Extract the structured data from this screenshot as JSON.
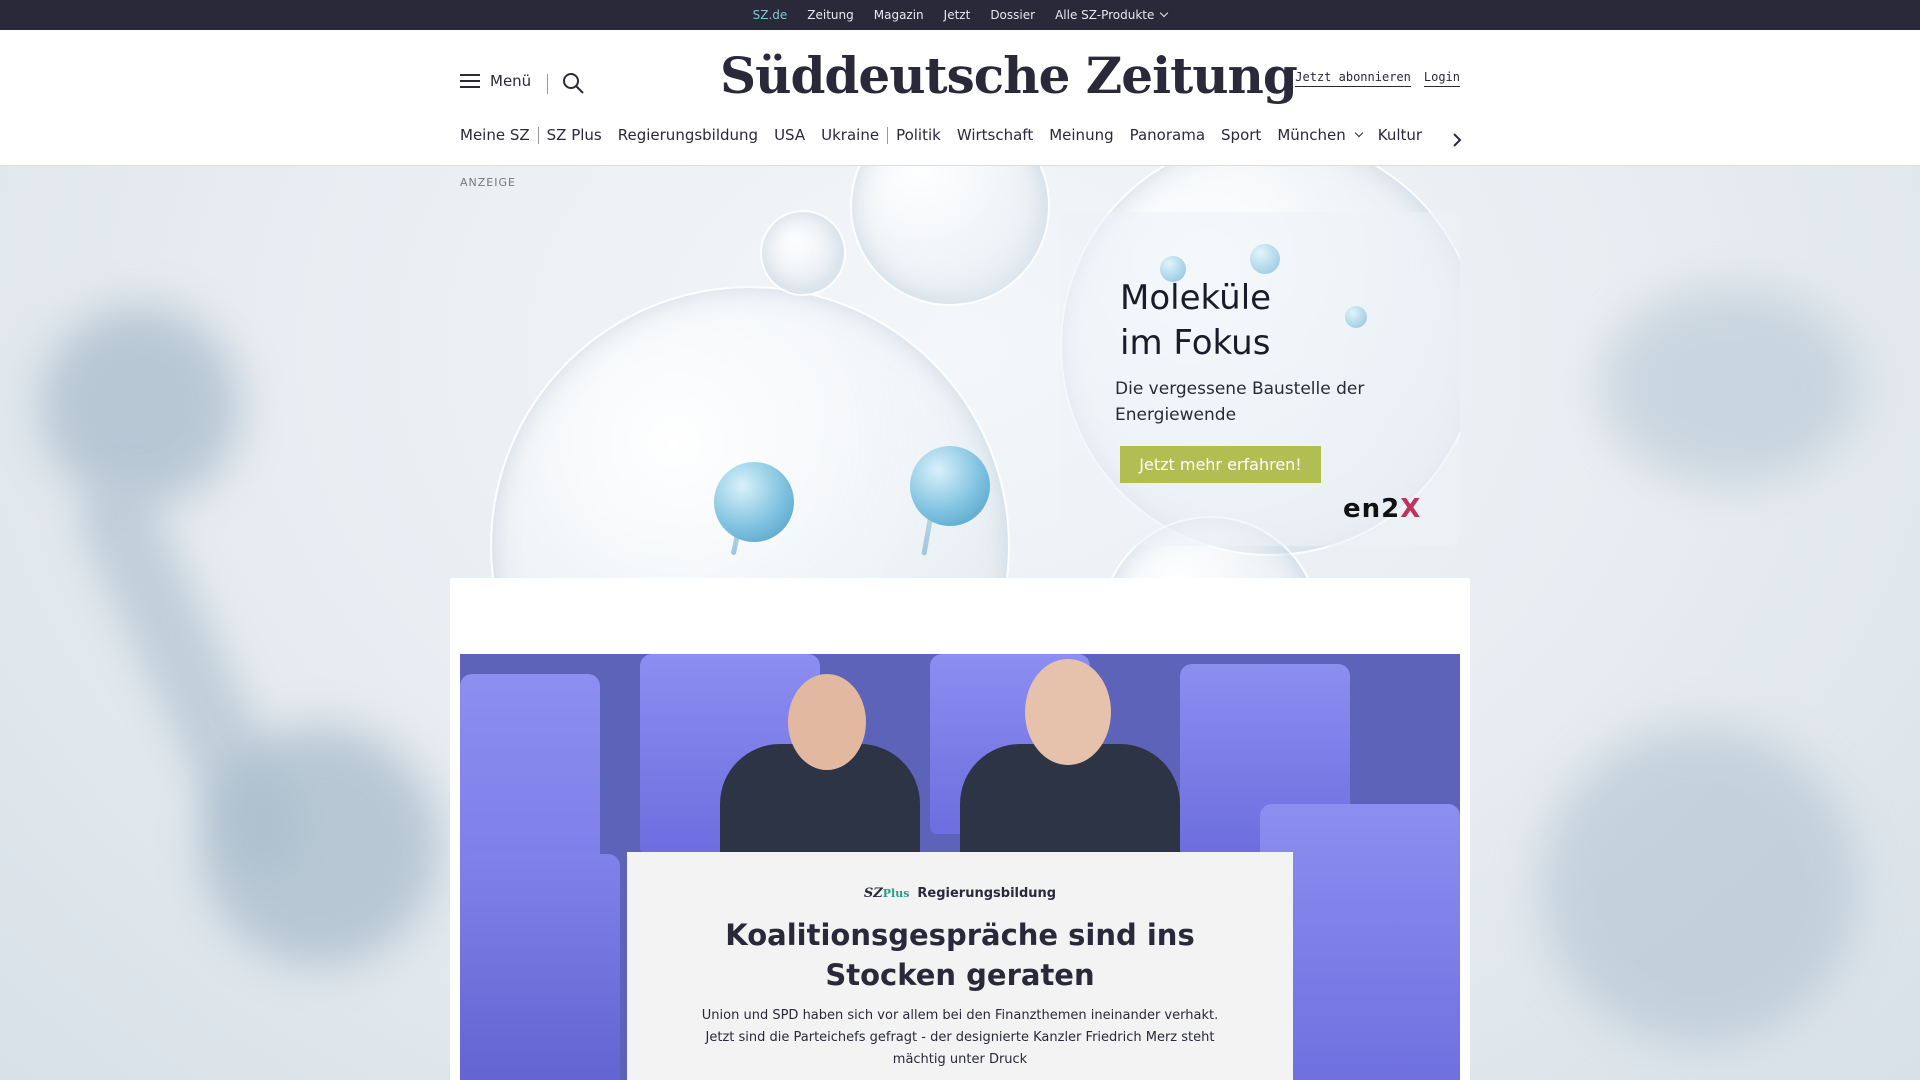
{
  "topbar": {
    "links": [
      "SZ.de",
      "Zeitung",
      "Magazin",
      "Jetzt",
      "Dossier",
      "Alle SZ-Produkte"
    ]
  },
  "header": {
    "menu_label": "Menü",
    "logo": "Süddeutsche Zeitung",
    "subscribe": "Jetzt abonnieren",
    "login": "Login"
  },
  "nav": {
    "items": [
      "Meine SZ",
      "SZ Plus",
      "Regierungsbildung",
      "USA",
      "Ukraine",
      "Politik",
      "Wirtschaft",
      "Meinung",
      "Panorama",
      "Sport",
      "München",
      "Kultur"
    ]
  },
  "ad": {
    "label": "ANZEIGE",
    "title_line1": "Moleküle",
    "title_line2": "im Fokus",
    "subtitle": "Die vergessene Baustelle der Energiewende",
    "cta": "Jetzt mehr erfahren!",
    "brand_main": "en2",
    "brand_x": "X"
  },
  "teaser": {
    "plus_brand": "SZ",
    "plus_suffix": "Plus",
    "kicker": "Regierungsbildung",
    "headline": "Koalitionsgespräche sind ins Stocken geraten",
    "lead": "Union und SPD haben sich vor allem bei den Finanzthemen ineinander verhakt. Jetzt sind die Parteichefs gefragt - der designierte Kanzler Friedrich Merz steht mächtig unter Druck"
  },
  "colors": {
    "topbar_bg": "#29293a",
    "active_link": "#7fc7d6",
    "cta_bg": "#b1bf52",
    "plus_accent": "#20a088"
  }
}
